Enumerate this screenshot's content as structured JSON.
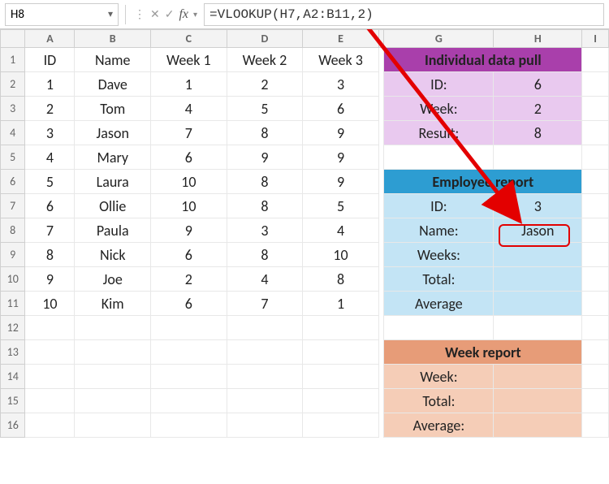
{
  "formula_bar": {
    "cell_ref": "H8",
    "formula": "=VLOOKUP(H7,A2:B11,2)",
    "fx_label": "fx"
  },
  "col_headers": [
    "A",
    "B",
    "C",
    "D",
    "E",
    "",
    "G",
    "H",
    "I"
  ],
  "row_headers": [
    "1",
    "2",
    "3",
    "4",
    "5",
    "6",
    "7",
    "8",
    "9",
    "10",
    "11",
    "12",
    "13",
    "14",
    "15",
    "16"
  ],
  "table_header": {
    "id": "ID",
    "name": "Name",
    "w1": "Week 1",
    "w2": "Week 2",
    "w3": "Week 3"
  },
  "rows": [
    {
      "id": "1",
      "name": "Dave",
      "w1": "1",
      "w2": "2",
      "w3": "3"
    },
    {
      "id": "2",
      "name": "Tom",
      "w1": "4",
      "w2": "5",
      "w3": "6"
    },
    {
      "id": "3",
      "name": "Jason",
      "w1": "7",
      "w2": "8",
      "w3": "9"
    },
    {
      "id": "4",
      "name": "Mary",
      "w1": "6",
      "w2": "9",
      "w3": "9"
    },
    {
      "id": "5",
      "name": "Laura",
      "w1": "10",
      "w2": "8",
      "w3": "9"
    },
    {
      "id": "6",
      "name": "Ollie",
      "w1": "10",
      "w2": "8",
      "w3": "5"
    },
    {
      "id": "7",
      "name": "Paula",
      "w1": "9",
      "w2": "3",
      "w3": "4"
    },
    {
      "id": "8",
      "name": "Nick",
      "w1": "6",
      "w2": "8",
      "w3": "10"
    },
    {
      "id": "9",
      "name": "Joe",
      "w1": "2",
      "w2": "4",
      "w3": "8"
    },
    {
      "id": "10",
      "name": "Kim",
      "w1": "6",
      "w2": "7",
      "w3": "1"
    }
  ],
  "panel_individual": {
    "title": "Individual data pull",
    "labels": {
      "id": "ID:",
      "week": "Week:",
      "result": "Result:"
    },
    "values": {
      "id": "6",
      "week": "2",
      "result": "8"
    }
  },
  "panel_employee": {
    "title": "Employee report",
    "labels": {
      "id": "ID:",
      "name": "Name:",
      "weeks": "Weeks:",
      "total": "Total:",
      "avg": "Average"
    },
    "values": {
      "id": "3",
      "name": "Jason",
      "weeks": "",
      "total": "",
      "avg": ""
    }
  },
  "panel_week": {
    "title": "Week report",
    "labels": {
      "week": "Week:",
      "total": "Total:",
      "avg": "Average:"
    },
    "values": {
      "week": "",
      "total": "",
      "avg": ""
    }
  }
}
